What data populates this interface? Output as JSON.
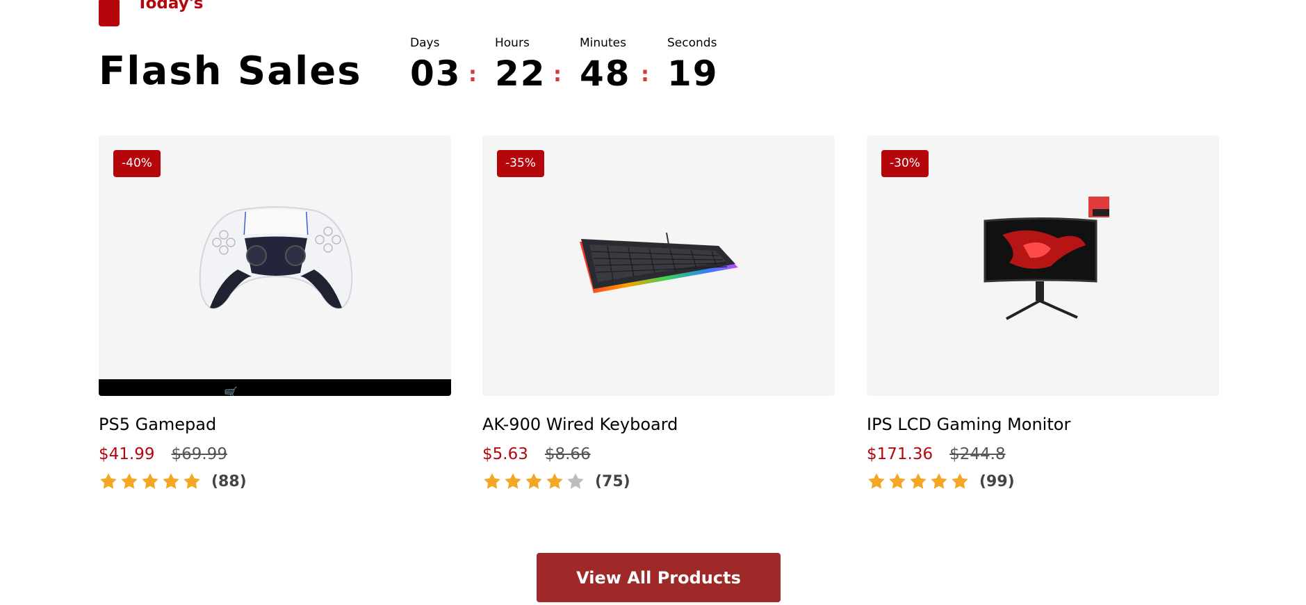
{
  "section_tag": "Today's",
  "page_title": "Flash Sales",
  "countdown": {
    "days_label": "Days",
    "days": "03",
    "hours_label": "Hours",
    "hours": "22",
    "minutes_label": "Minutes",
    "minutes": "48",
    "seconds_label": "Seconds",
    "seconds": "19",
    "separator": ":"
  },
  "colors": {
    "accent": "#b5070b",
    "star": "#f5a623",
    "star_empty": "#bdbdbd",
    "button": "#9f2929"
  },
  "products": [
    {
      "discount": "-40%",
      "name": "PS5 Gamepad",
      "price": "$41.99",
      "old_price": "$69.99",
      "rating": 5,
      "reviews": "(88)",
      "image": "gamepad"
    },
    {
      "discount": "-35%",
      "name": "AK-900 Wired Keyboard",
      "price": "$5.63",
      "old_price": "$8.66",
      "rating": 4,
      "reviews": "(75)",
      "image": "keyboard"
    },
    {
      "discount": "-30%",
      "name": "IPS LCD Gaming Monitor",
      "price": "$171.36",
      "old_price": "$244.8",
      "rating": 5,
      "reviews": "(99)",
      "image": "monitor"
    }
  ],
  "view_all_label": "View All Products"
}
